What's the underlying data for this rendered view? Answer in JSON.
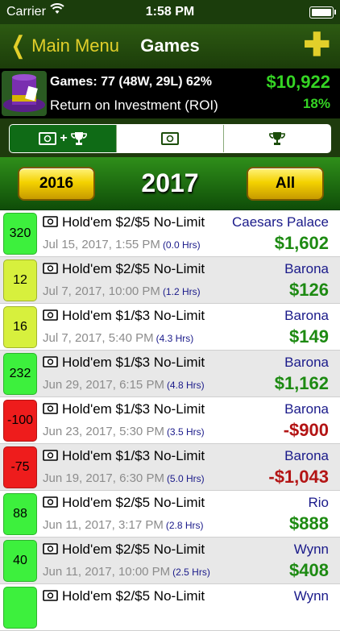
{
  "status_bar": {
    "carrier": "Carrier",
    "time": "1:58 PM"
  },
  "nav": {
    "back_label": "Main Menu",
    "title": "Games"
  },
  "summary": {
    "games_line": "Games: 77 (48W, 29L) 62%",
    "roi_label": "Return on Investment (ROI)",
    "total": "$10,922",
    "roi": "18%"
  },
  "segments": [
    {
      "name": "cash-plus-tournament",
      "selected": true
    },
    {
      "name": "cash-only",
      "selected": false
    },
    {
      "name": "tournament-only",
      "selected": false
    }
  ],
  "year_selector": {
    "prev_year": "2016",
    "current_year": "2017",
    "all_label": "All"
  },
  "colors": {
    "positive_badge": "#3df03d",
    "neutral_badge": "#d7f03d",
    "negative_badge": "#ee1c1c",
    "amount_positive": "#1d8a12",
    "amount_negative": "#b31414",
    "venue": "#1a1a8a"
  },
  "games": [
    {
      "badge": "320",
      "badge_color": "#3df03d",
      "game": "Hold'em $2/$5 No-Limit",
      "venue": "Caesars Palace",
      "date": "Jul 15, 2017, 1:55 PM",
      "hours": "(0.0 Hrs)",
      "amount": "$1,602",
      "negative": false
    },
    {
      "badge": "12",
      "badge_color": "#d7f03d",
      "game": "Hold'em $2/$5 No-Limit",
      "venue": "Barona",
      "date": "Jul 7, 2017, 10:00 PM",
      "hours": "(1.2 Hrs)",
      "amount": "$126",
      "negative": false
    },
    {
      "badge": "16",
      "badge_color": "#d7f03d",
      "game": "Hold'em $1/$3 No-Limit",
      "venue": "Barona",
      "date": "Jul 7, 2017, 5:40 PM",
      "hours": "(4.3 Hrs)",
      "amount": "$149",
      "negative": false
    },
    {
      "badge": "232",
      "badge_color": "#3df03d",
      "game": "Hold'em $1/$3 No-Limit",
      "venue": "Barona",
      "date": "Jun 29, 2017, 6:15 PM",
      "hours": "(4.8 Hrs)",
      "amount": "$1,162",
      "negative": false
    },
    {
      "badge": "-100",
      "badge_color": "#ee1c1c",
      "game": "Hold'em $1/$3 No-Limit",
      "venue": "Barona",
      "date": "Jun 23, 2017, 5:30 PM",
      "hours": "(3.5 Hrs)",
      "amount": "-$900",
      "negative": true
    },
    {
      "badge": "-75",
      "badge_color": "#ee1c1c",
      "game": "Hold'em $1/$3 No-Limit",
      "venue": "Barona",
      "date": "Jun 19, 2017, 6:30 PM",
      "hours": "(5.0 Hrs)",
      "amount": "-$1,043",
      "negative": true
    },
    {
      "badge": "88",
      "badge_color": "#3df03d",
      "game": "Hold'em $2/$5 No-Limit",
      "venue": "Rio",
      "date": "Jun 11, 2017, 3:17 PM",
      "hours": "(2.8 Hrs)",
      "amount": "$888",
      "negative": false
    },
    {
      "badge": "40",
      "badge_color": "#3df03d",
      "game": "Hold'em $2/$5 No-Limit",
      "venue": "Wynn",
      "date": "Jun 11, 2017, 10:00 PM",
      "hours": "(2.5 Hrs)",
      "amount": "$408",
      "negative": false
    },
    {
      "badge": "",
      "badge_color": "#3df03d",
      "game": "Hold'em $2/$5 No-Limit",
      "venue": "Wynn",
      "date": "",
      "hours": "",
      "amount": "",
      "negative": false
    }
  ]
}
